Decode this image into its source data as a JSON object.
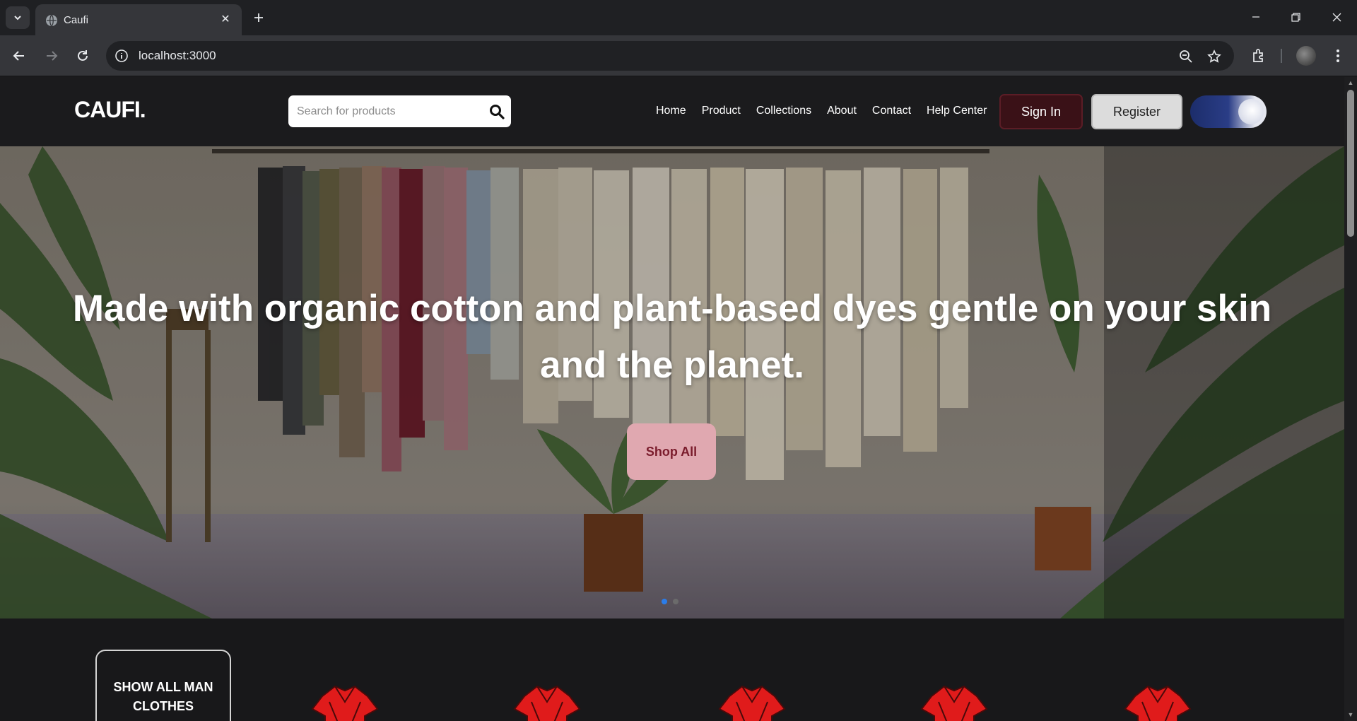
{
  "browser": {
    "tab_title": "Caufi",
    "url": "localhost:3000",
    "icons": [
      "tab-search-icon",
      "globe-icon",
      "close-icon",
      "plus-icon",
      "minimize-icon",
      "restore-icon",
      "window-close-icon",
      "back-icon",
      "forward-icon",
      "reload-icon",
      "info-icon",
      "zoom-out-icon",
      "star-icon",
      "extensions-icon",
      "menu-icon"
    ]
  },
  "header": {
    "logo": "CAUFI.",
    "search_placeholder": "Search for products",
    "nav": [
      "Home",
      "Product",
      "Collections",
      "About",
      "Contact",
      "Help Center"
    ],
    "sign_in": "Sign In",
    "register": "Register",
    "theme_toggle_on": true
  },
  "hero": {
    "title": "Made with organic cotton and plant-based dyes gentle on your skin and the planet.",
    "cta": "Shop All",
    "slide_count": 2,
    "active_slide": 1
  },
  "categories": {
    "show_all_label": "SHOW ALL MAN CLOTHES",
    "item_count": 5,
    "item_color": "#e01b1b"
  }
}
